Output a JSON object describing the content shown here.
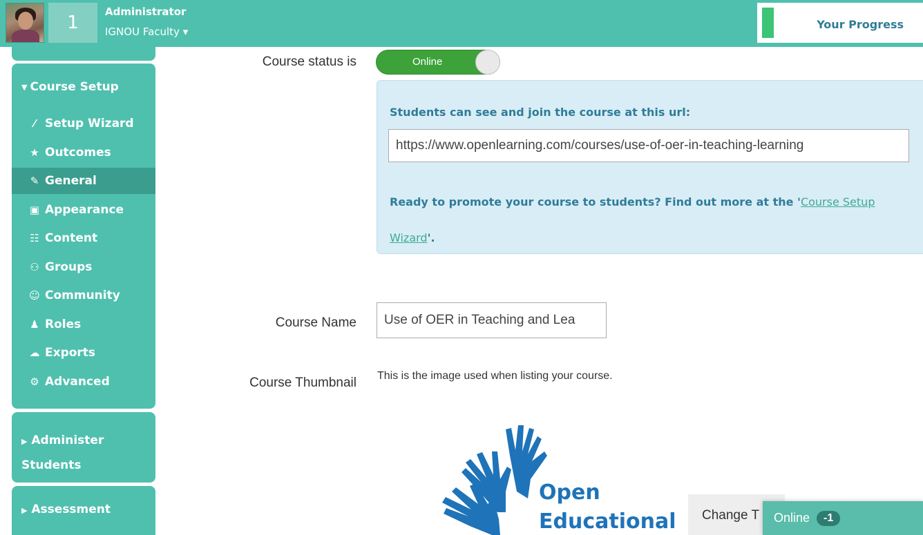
{
  "header": {
    "notification_count": "1",
    "user_role": "Administrator",
    "user_org": "IGNOU Faculty ▾",
    "progress_label": "Your Progress",
    "progress_fraction": 0.07
  },
  "sidebar": {
    "course_setup": {
      "title": "Course Setup",
      "items": [
        {
          "label": "Setup Wizard",
          "icon": "magic-wand-icon",
          "glyph": "⁄"
        },
        {
          "label": "Outcomes",
          "icon": "star-icon",
          "glyph": "★"
        },
        {
          "label": "General",
          "icon": "edit-icon",
          "glyph": "✎"
        },
        {
          "label": "Appearance",
          "icon": "image-icon",
          "glyph": "▣"
        },
        {
          "label": "Content",
          "icon": "sitemap-icon",
          "glyph": "☷"
        },
        {
          "label": "Groups",
          "icon": "users-icon",
          "glyph": "⚇"
        },
        {
          "label": "Community",
          "icon": "smile-icon",
          "glyph": "☺"
        },
        {
          "label": "Roles",
          "icon": "user-icon",
          "glyph": "♟"
        },
        {
          "label": "Exports",
          "icon": "cloud-upload-icon",
          "glyph": "☁"
        },
        {
          "label": "Advanced",
          "icon": "cogs-icon",
          "glyph": "⚙"
        }
      ],
      "active_index": 2
    },
    "administer_students": {
      "line1": "Administer",
      "line2": "Students"
    },
    "assessment": {
      "title": "Assessment"
    }
  },
  "main": {
    "status_label": "Course status is",
    "status_toggle": "Online",
    "info": {
      "heading": "Students can see and join the course at this url:",
      "url": "https://www.openlearning.com/courses/use-of-oer-in-teaching-learning",
      "promo_text": "Ready to promote your course to students? Find out more at the '",
      "promo_link": "Course Setup Wizard",
      "promo_end": "'."
    },
    "course_name_label": "Course Name",
    "course_name_value": "Use of OER in Teaching and Lea",
    "thumbnail_label": "Course Thumbnail",
    "thumbnail_desc": "This is the image used when listing your course.",
    "logo": {
      "line1": "Open",
      "line2": "Educational"
    },
    "change_button": "Change T"
  },
  "chat": {
    "label": "Online",
    "count": "-1"
  },
  "colors": {
    "teal": "#4fc0ae",
    "active": "#3a9d8e",
    "info_bg": "#d9edf7",
    "info_text": "#2f7d97",
    "toggle_green": "#3ea23b",
    "logo_blue": "#1f73b8"
  }
}
